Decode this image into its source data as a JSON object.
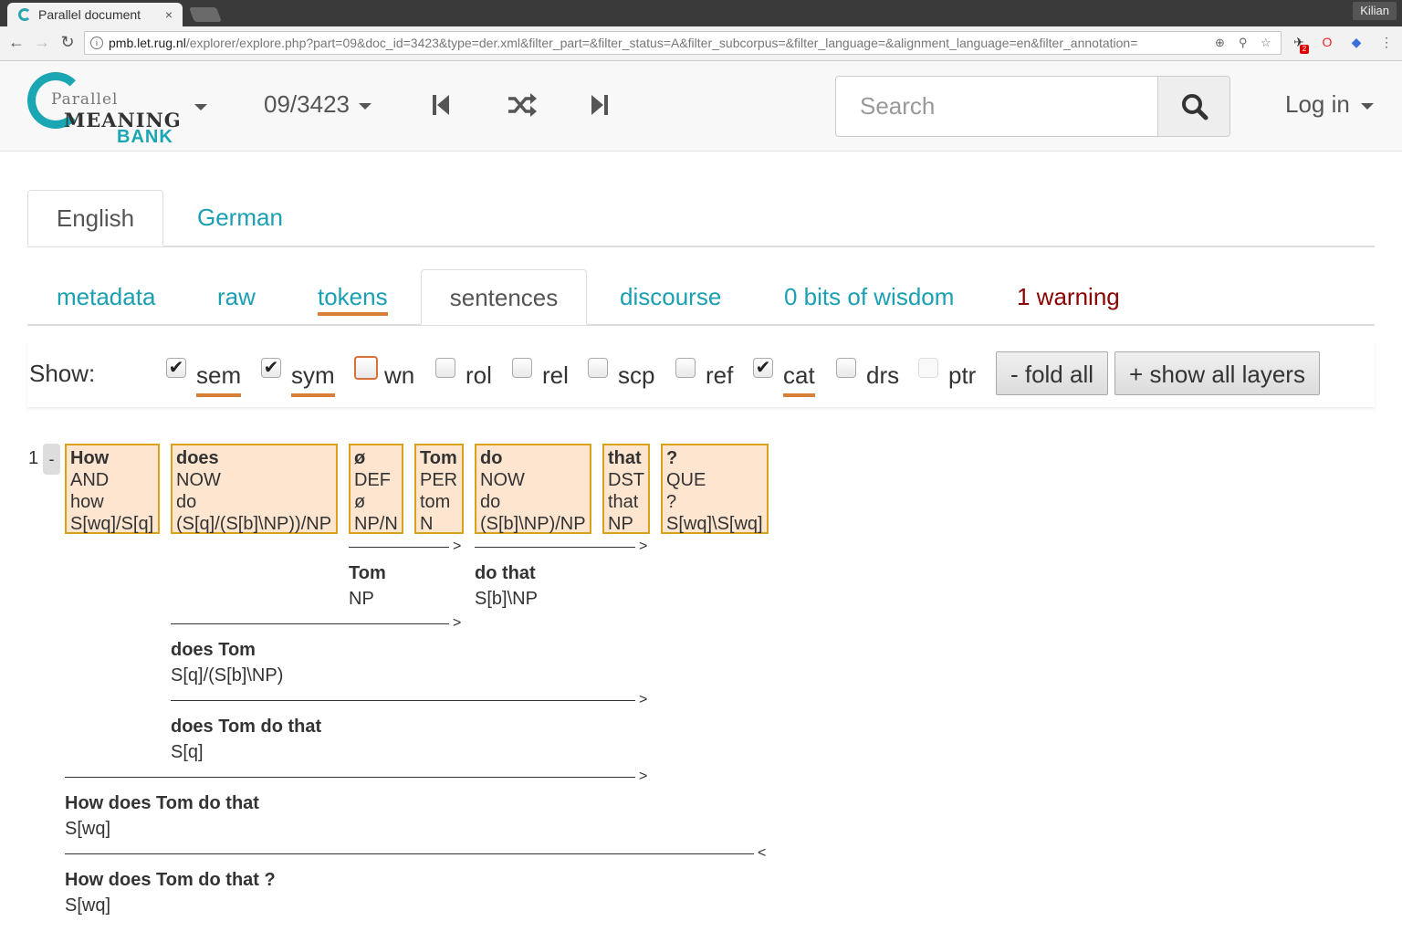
{
  "browser": {
    "tab_title": "Parallel document",
    "tab_close": "×",
    "profile": "Kilian",
    "url_host": "pmb.let.rug.nl",
    "url_path": "/explorer/explore.php?part=09&doc_id=3423&type=der.xml&filter_part=&filter_status=A&filter_subcorpus=&filter_language=&alignment_language=en&filter_annotation=",
    "ext_badge": "2"
  },
  "header": {
    "logo_line1": "Parallel",
    "logo_line2": "MEANING",
    "logo_line3": "BANK",
    "doc_id": "09/3423",
    "search_placeholder": "Search",
    "login_label": "Log in"
  },
  "language_tabs": [
    {
      "label": "English",
      "active": true
    },
    {
      "label": "German",
      "active": false
    }
  ],
  "layer_tabs": [
    {
      "label": "metadata"
    },
    {
      "label": "raw"
    },
    {
      "label": "tokens"
    },
    {
      "label": "sentences"
    },
    {
      "label": "discourse"
    },
    {
      "label": "0 bits of wisdom"
    },
    {
      "label": "1 warning"
    }
  ],
  "show_bar": {
    "label": "Show:",
    "options": [
      {
        "label": "sem",
        "checked": true
      },
      {
        "label": "sym",
        "checked": true
      },
      {
        "label": "wn",
        "checked": false
      },
      {
        "label": "rol",
        "checked": false
      },
      {
        "label": "rel",
        "checked": false
      },
      {
        "label": "scp",
        "checked": false
      },
      {
        "label": "ref",
        "checked": false
      },
      {
        "label": "cat",
        "checked": true
      },
      {
        "label": "drs",
        "checked": false
      },
      {
        "label": "ptr",
        "checked": false
      }
    ],
    "fold_all": "- fold all",
    "show_all": "+ show all layers"
  },
  "derivation": {
    "sentence_number": "1",
    "fold_label": "-",
    "tokens": [
      {
        "word": "How",
        "sem": "AND",
        "sym": "how",
        "cat": "S[wq]/S[q]"
      },
      {
        "word": "does",
        "sem": "NOW",
        "sym": "do",
        "cat": "(S[q]/(S[b]\\NP))/NP"
      },
      {
        "word": "ø",
        "sem": "DEF",
        "sym": "ø",
        "cat": "NP/N"
      },
      {
        "word": "Tom",
        "sem": "PER",
        "sym": "tom",
        "cat": "N"
      },
      {
        "word": "do",
        "sem": "NOW",
        "sym": "do",
        "cat": "(S[b]\\NP)/NP"
      },
      {
        "word": "that",
        "sem": "DST",
        "sym": "that",
        "cat": "NP"
      },
      {
        "word": "?",
        "sem": "QUE",
        "sym": "?",
        "cat": "S[wq]\\S[wq]"
      }
    ],
    "nodes": [
      {
        "words": "Tom",
        "cat": "NP",
        "rule": ">"
      },
      {
        "words": "do that",
        "cat": "S[b]\\NP",
        "rule": ">"
      },
      {
        "words": "does Tom",
        "cat": "S[q]/(S[b]\\NP)",
        "rule": ">"
      },
      {
        "words": "does Tom do that",
        "cat": "S[q]",
        "rule": ">"
      },
      {
        "words": "How does Tom do that",
        "cat": "S[wq]",
        "rule": ">"
      },
      {
        "words": "How does Tom do that ?",
        "cat": "S[wq]",
        "rule": "<"
      }
    ]
  }
}
